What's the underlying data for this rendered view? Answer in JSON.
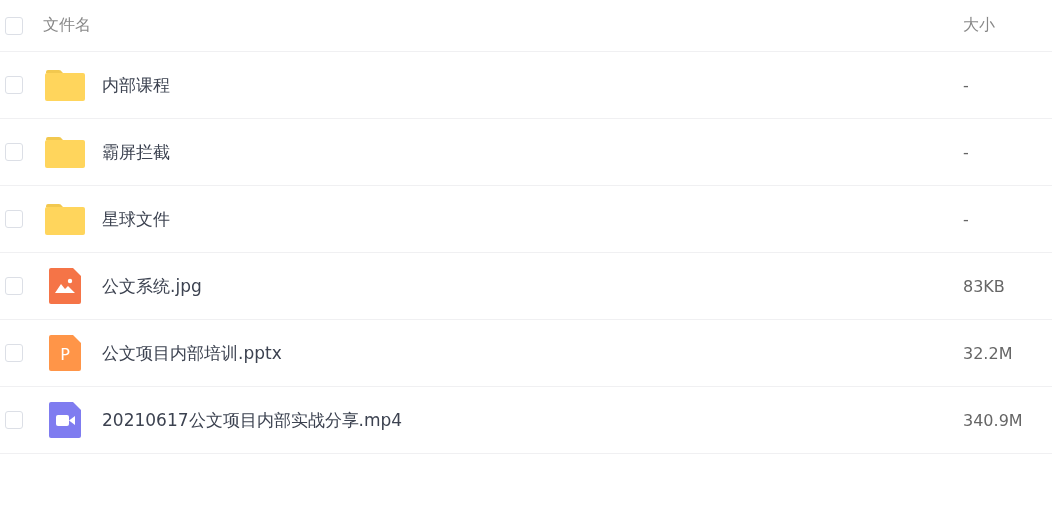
{
  "header": {
    "checked": false,
    "name_label": "文件名",
    "size_label": "大小"
  },
  "files": [
    {
      "kind": "folder",
      "name": "内部课程",
      "size": "-",
      "checked": false
    },
    {
      "kind": "folder",
      "name": "霸屏拦截",
      "size": "-",
      "checked": false
    },
    {
      "kind": "folder",
      "name": "星球文件",
      "size": "-",
      "checked": false
    },
    {
      "kind": "image",
      "name": "公文系统.jpg",
      "size": "83KB",
      "checked": false
    },
    {
      "kind": "ppt",
      "icon_letter": "P",
      "name": "公文项目内部培训.pptx",
      "size": "32.2M",
      "checked": false
    },
    {
      "kind": "video",
      "name": "20210617公文项目内部实战分享.mp4",
      "size": "340.9M",
      "checked": false
    }
  ]
}
